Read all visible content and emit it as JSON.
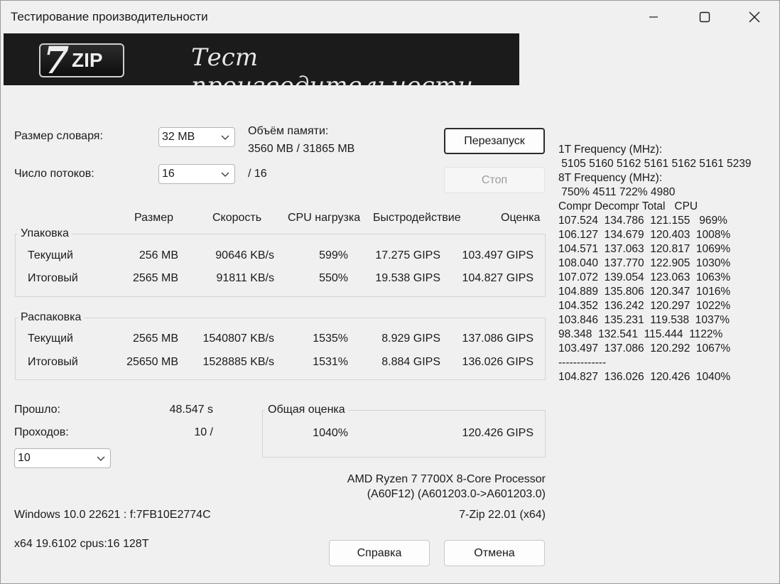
{
  "window": {
    "title": "Тестирование производительности"
  },
  "banner": {
    "logo_7": "7",
    "logo_zip": "ZIP",
    "text": "Тест производительности"
  },
  "dict": {
    "label": "Размер словаря:",
    "value": "32 MB"
  },
  "threads": {
    "label": "Число потоков:",
    "value": "16",
    "max": "/ 16"
  },
  "memory": {
    "label": "Объём памяти:",
    "value": "3560 MB / 31865 MB"
  },
  "buttons": {
    "restart": "Перезапуск",
    "stop": "Стоп",
    "help": "Справка",
    "cancel": "Отмена"
  },
  "headers": {
    "size": "Размер",
    "speed": "Скорость",
    "cpu": "CPU нагрузка",
    "perf": "Быстродействие",
    "rating": "Оценка"
  },
  "compress": {
    "title": "Упаковка",
    "rows": [
      {
        "label": "Текущий",
        "size": "256 MB",
        "speed": "90646 KB/s",
        "cpu": "599%",
        "perf": "17.275 GIPS",
        "rating": "103.497 GIPS"
      },
      {
        "label": "Итоговый",
        "size": "2565 MB",
        "speed": "91811 KB/s",
        "cpu": "550%",
        "perf": "19.538 GIPS",
        "rating": "104.827 GIPS"
      }
    ]
  },
  "decompress": {
    "title": "Распаковка",
    "rows": [
      {
        "label": "Текущий",
        "size": "2565 MB",
        "speed": "1540807 KB/s",
        "cpu": "1535%",
        "perf": "8.929 GIPS",
        "rating": "137.086 GIPS"
      },
      {
        "label": "Итоговый",
        "size": "25650 MB",
        "speed": "1528885 KB/s",
        "cpu": "1531%",
        "perf": "8.884 GIPS",
        "rating": "136.026 GIPS"
      }
    ]
  },
  "elapsed": {
    "label": "Прошло:",
    "value": "48.547 s"
  },
  "passes": {
    "label": "Проходов:",
    "value": "10 /",
    "select": "10"
  },
  "total": {
    "title": "Общая оценка",
    "cpu": "1040%",
    "rating": "120.426 GIPS"
  },
  "cpu_info": {
    "line1": "AMD Ryzen 7 7700X 8-Core Processor",
    "line2": "(A60F12) (A601203.0->A601203.0)"
  },
  "version": "7-Zip 22.01 (x64)",
  "os_info": "Windows 10.0 22621 :  f:7FB10E2774C",
  "arch_info": "x64 19.6102 cpus:16 128T",
  "log": [
    "1T Frequency (MHz):",
    " 5105 5160 5162 5161 5162 5161 5239",
    "8T Frequency (MHz):",
    " 750% 4511 722% 4980",
    "Compr Decompr Total   CPU",
    "107.524  134.786  121.155   969%",
    "106.127  134.679  120.403  1008%",
    "104.571  137.063  120.817  1069%",
    "108.040  137.770  122.905  1030%",
    "107.072  139.054  123.063  1063%",
    "104.889  135.806  120.347  1016%",
    "104.352  136.242  120.297  1022%",
    "103.846  135.231  119.538  1037%",
    "98.348  132.541  115.444  1122%",
    "103.497  137.086  120.292  1067%",
    "-------------",
    "104.827  136.026  120.426  1040%"
  ]
}
